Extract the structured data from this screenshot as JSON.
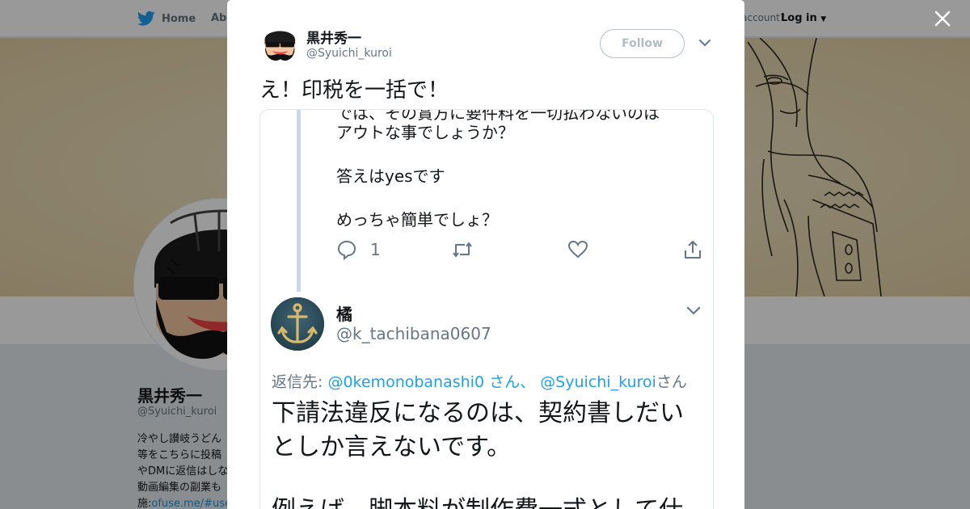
{
  "topnav": {
    "home_label": "Home",
    "about_label": "Abo",
    "account_prompt": "account?",
    "login_label": "Log in"
  },
  "profile": {
    "name": "黒井秀一",
    "handle": "@Syuichi_kuroi",
    "bio_lines": [
      "冷やし讃岐うどん",
      "等をこちらに投稿",
      "やDMに返信はしな",
      "動画編集の副業も",
      "施:"
    ],
    "bio_link": "ofuse.me/#use"
  },
  "modal": {
    "author_name": "黒井秀一",
    "author_handle": "@Syuichi_kuroi",
    "follow_label": "Follow",
    "tweet_text": "え！印税を一括で！",
    "screenshot": {
      "cut_line": "では、その賞方に要件料を一切払わないのは",
      "line1": "アウトな事でしょうか？",
      "line2": "答えはyesです",
      "line3": "めっちゃ簡単でしょ？",
      "reply_count": "1",
      "reply_user_name": "橘",
      "reply_user_handle": "@k_tachibana0607",
      "reply_to_prefix": "返信先:",
      "reply_to_mention1": "@0kemonobanashi0",
      "reply_to_san1": "さん、",
      "reply_to_mention2": "@Syuichi_kuroi",
      "reply_to_san2": "さん",
      "body_line1": "下請法違反になるのは、契約書しだい",
      "body_line2": "としか言えないです。",
      "body_line3": "例えば、脚本料が制作費一式として仕"
    }
  },
  "colors": {
    "twitter_blue": "#1da1f2",
    "text": "#14171a",
    "secondary": "#657786",
    "overlay": "rgba(0,0,0,0.4)"
  }
}
